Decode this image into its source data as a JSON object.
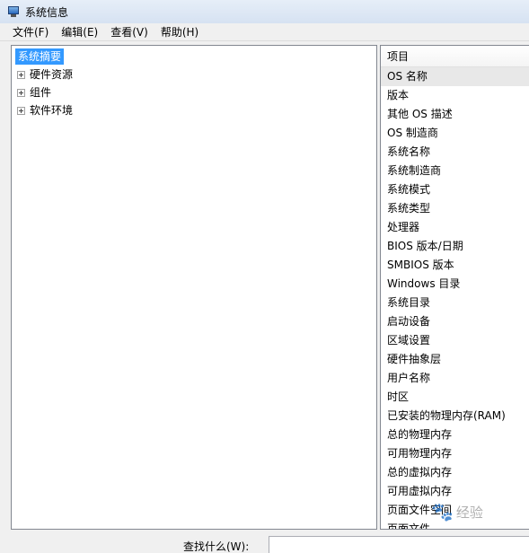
{
  "window": {
    "title": "系统信息",
    "icon": "system-info-icon"
  },
  "menu": [
    "文件(F)",
    "编辑(E)",
    "查看(V)",
    "帮助(H)"
  ],
  "tree": {
    "root": "系统摘要",
    "children": [
      "硬件资源",
      "组件",
      "软件环境"
    ]
  },
  "details": {
    "column_header": "项目",
    "items": [
      "OS 名称",
      "版本",
      "其他 OS 描述",
      "OS 制造商",
      "系统名称",
      "系统制造商",
      "系统模式",
      "系统类型",
      "处理器",
      "BIOS 版本/日期",
      "SMBIOS 版本",
      "Windows 目录",
      "系统目录",
      "启动设备",
      "区域设置",
      "硬件抽象层",
      "用户名称",
      "时区",
      "已安装的物理内存(RAM)",
      "总的物理内存",
      "可用物理内存",
      "总的虚拟内存",
      "可用虚拟内存",
      "页面文件空间",
      "页面文件"
    ]
  },
  "find": {
    "label": "查找什么(W):",
    "value": ""
  },
  "watermark": {
    "text": "经验",
    "icon": "paw-icon"
  }
}
